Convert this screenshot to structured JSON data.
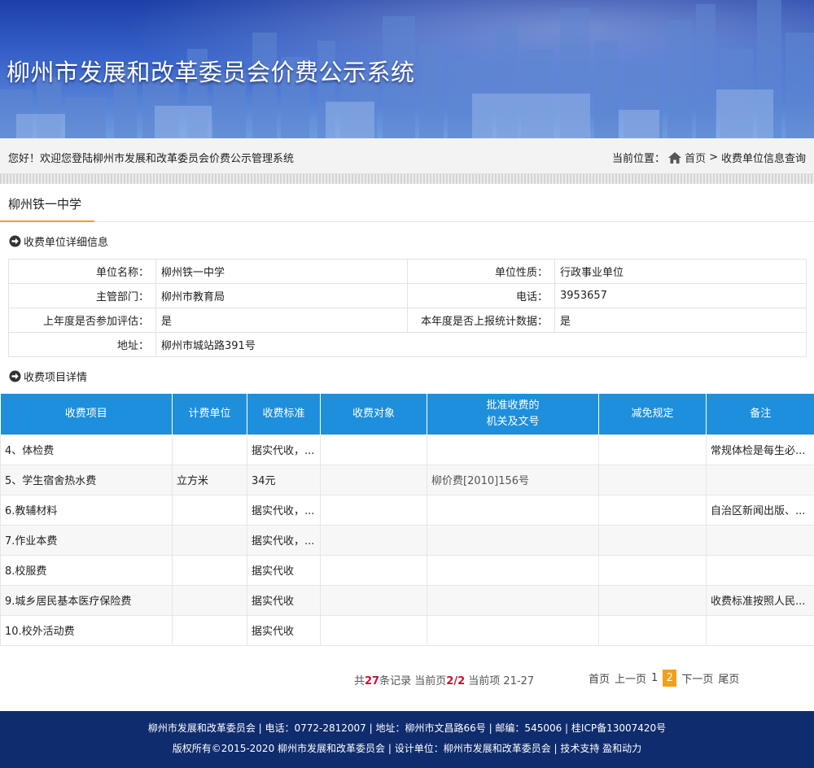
{
  "header": {
    "title": "柳州市发展和改革委员会价费公示系统"
  },
  "welcome": {
    "message": "您好！欢迎您登陆柳州市发展和改革委员会价费公示管理系统",
    "location_label": "当前位置：",
    "home": "首页",
    "separator": ">",
    "current": "收费单位信息查询"
  },
  "tab": {
    "label": "柳州铁一中学"
  },
  "unit_section": {
    "title": "收费单位详细信息"
  },
  "unit": {
    "name_label": "单位名称：",
    "name": "柳州铁一中学",
    "nature_label": "单位性质：",
    "nature": "行政事业单位",
    "dept_label": "主管部门：",
    "dept": "柳州市教育局",
    "phone_label": "电话：",
    "phone": "3953657",
    "eval_label": "上年度是否参加评估：",
    "eval": "是",
    "report_label": "本年度是否上报统计数据：",
    "report": "是",
    "addr_label": "地址：",
    "addr": "柳州市城站路391号"
  },
  "fee_section": {
    "title": "收费项目详情"
  },
  "fee_table": {
    "headers": [
      "收费项目",
      "计费单位",
      "收费标准",
      "收费对象",
      "批准收费的",
      "机关及文号",
      "减免规定",
      "备注"
    ],
    "rows": [
      [
        "4、体检费",
        "",
        "据实代收，...",
        "",
        "",
        "",
        "常规体检是每生必..."
      ],
      [
        "5、学生宿舍热水费",
        "立方米",
        "34元",
        "",
        "柳价费[2010]156号",
        "",
        ""
      ],
      [
        "6.教辅材料",
        "",
        "据实代收，...",
        "",
        "",
        "",
        "自治区新闻出版、..."
      ],
      [
        "7.作业本费",
        "",
        "据实代收，...",
        "",
        "",
        "",
        ""
      ],
      [
        "8.校服费",
        "",
        "据实代收",
        "",
        "",
        "",
        ""
      ],
      [
        "9.城乡居民基本医疗保险费",
        "",
        "据实代收",
        "",
        "",
        "",
        "收费标准按照人民..."
      ],
      [
        "10.校外活动费",
        "",
        "据实代收",
        "",
        "",
        "",
        ""
      ]
    ]
  },
  "pager": {
    "total_prefix": "共",
    "total": "27",
    "total_suffix": "条记录",
    "page_prefix": "当前页",
    "page": "2/2",
    "range_prefix": "当前项",
    "range": "21-27",
    "first": "首页",
    "prev": "上一页",
    "p1": "1",
    "p2": "2",
    "next": "下一页",
    "last": "尾页"
  },
  "footer": {
    "line1": "柳州市发展和改革委员会 | 电话：0772-2812007 | 地址：柳州市文昌路66号 | 邮编：545006 | 桂ICP备13007420号",
    "line2": "版权所有©2015-2020 柳州市发展和改革委员会 | 设计单位：柳州市发展和改革委员会 | 技术支持 盈和动力"
  }
}
